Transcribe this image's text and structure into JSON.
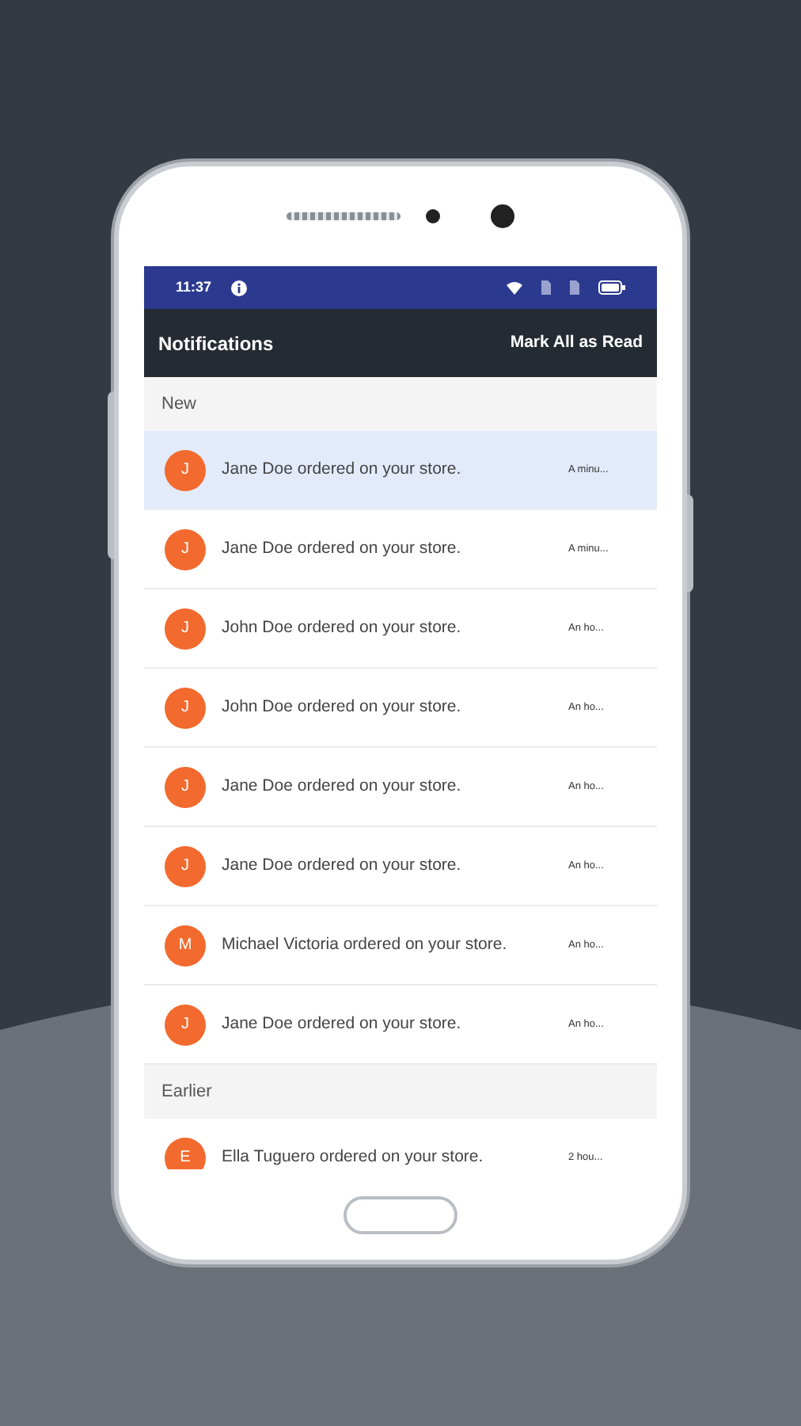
{
  "status_bar": {
    "time": "11:37"
  },
  "app_bar": {
    "title": "Notifications",
    "action": "Mark All as Read"
  },
  "sections": [
    {
      "title": "New",
      "items": [
        {
          "initial": "J",
          "message": "Jane Doe ordered on your store.",
          "time": "A minu...",
          "selected": true
        },
        {
          "initial": "J",
          "message": "Jane Doe ordered on your store.",
          "time": "A minu...",
          "selected": false
        },
        {
          "initial": "J",
          "message": "John Doe ordered on your store.",
          "time": "An ho...",
          "selected": false
        },
        {
          "initial": "J",
          "message": "John Doe ordered on your store.",
          "time": "An ho...",
          "selected": false
        },
        {
          "initial": "J",
          "message": "Jane Doe ordered on your store.",
          "time": "An ho...",
          "selected": false
        },
        {
          "initial": "J",
          "message": "Jane Doe ordered on your store.",
          "time": "An ho...",
          "selected": false
        },
        {
          "initial": "M",
          "message": "Michael Victoria ordered on your store.",
          "time": "An ho...",
          "selected": false
        },
        {
          "initial": "J",
          "message": "Jane Doe ordered on your store.",
          "time": "An ho...",
          "selected": false
        }
      ]
    },
    {
      "title": "Earlier",
      "items": [
        {
          "initial": "E",
          "message": "Ella Tuguero ordered on your store.",
          "time": "2 hou...",
          "selected": false
        }
      ]
    }
  ]
}
